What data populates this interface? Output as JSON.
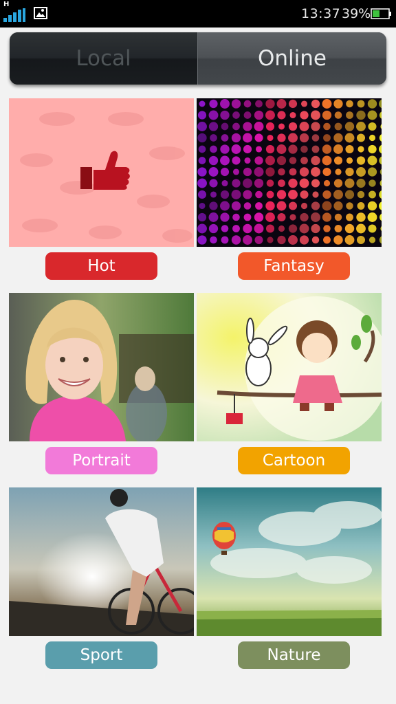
{
  "status_bar": {
    "network_letter": "H",
    "time": "13:37",
    "battery": "39%"
  },
  "tabs": {
    "local": "Local",
    "online": "Online",
    "selected": "Online"
  },
  "categories": [
    {
      "label": "Hot",
      "color": "#d9282c",
      "icon": "thumbs-up-icon"
    },
    {
      "label": "Fantasy",
      "color": "#f2582a"
    },
    {
      "label": "Portrait",
      "color": "#f27ad9"
    },
    {
      "label": "Cartoon",
      "color": "#f2a300"
    },
    {
      "label": "Sport",
      "color": "#5a9eac"
    },
    {
      "label": "Nature",
      "color": "#7d8f5e"
    }
  ]
}
